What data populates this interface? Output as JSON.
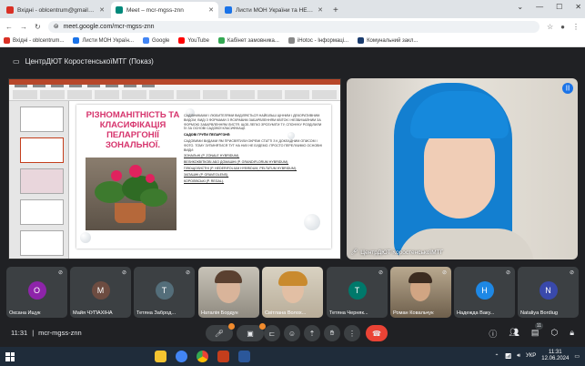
{
  "browser": {
    "tabs": [
      {
        "label": "Вхідні - oblcentrum@gmail.com",
        "favicon_color": "#d93025"
      },
      {
        "label": "Meet – mcr-mgss-znn",
        "favicon_color": "#00897b"
      },
      {
        "label": "Листи МОН України та НЕНЦ",
        "favicon_color": "#1a73e8"
      }
    ],
    "new_tab": "+",
    "url": "meet.google.com/mcr-mgss-znn",
    "bookmarks": [
      {
        "label": "Вхідні - oblcentrum...",
        "color": "#d93025"
      },
      {
        "label": "Листи МОН Україн...",
        "color": "#1a73e8"
      },
      {
        "label": "Google",
        "color": "#4285f4"
      },
      {
        "label": "YouTube",
        "color": "#ff0000"
      },
      {
        "label": "Кабінет замовника...",
        "color": "#34a853"
      },
      {
        "label": "iHotoc - Інформаці...",
        "color": "#888888"
      },
      {
        "label": "Комунальний закл...",
        "color": "#1a3c6e"
      }
    ]
  },
  "meet": {
    "presenter_title": "ЦентрДЮТ КоростенськоїМТГ (Показ)",
    "slide": {
      "title": "РІЗНОМАНІТНІСТЬ ТА КЛАСИФІКАЦІЯ ПЕЛАРГОНІЇ ЗОНАЛЬНОЇ.",
      "paragraphs": [
        "САДІВНИКАМИ І ЛЮБИТЕЛЯМИ ВИДІЛЯЄТЬСЯ НАЙБІЛЬШ ЦІННИМ І ДЕКОРАТИВНИМ ВИДОМ, ВИДІ З ФОРМАМИ З ЯСКРАВИМ ЗАБАРВЛЕННЯМ КВІТОК І НЕЗВИЧАЙНИМ ЗА ФОРМОЮ ЗАБАРВЛЕННЯМ ЛИСТЯ. ЩОБ ЛЕГКО ЗРОЗУМІТИ ТУ, СПОНУКУ РОЗДІЛИЛИ ЇХ ЗА ОСНОВІ САДОВОЇ КЛАСИФІКАЦІЇ.",
        "САДОВІ ГРУПИ ПЕЛАРГОНІЇ:",
        "САДОВИМИ ВИДАМИ ЯМ ПРИСВЯТИЛИ ОКРЕМІ СТАТТІ З К ДОКЛАДНИМ ОПИСОМ І ФОТО. ТОМУ ЗУПИНЯТИСЯ ТУТ НА НИХ НЕ БУДЕМО. ПРОСТО ПЕРЕЛІЧИМО ОСНОВНІ ВИДИ:",
        "ЗОНАЛЬНІ (P. ZONALE HYBRIDUM).",
        "ВЕЛИКОКВІТКОВІ АБО ДОМАШНІ (P. GRANDIFLORUM HYBRIDUM).",
        "ПЛЮЩОЛИСТНІ (P. HEDERIFOLIUM HYBRIDUM, PELTATUM HYBRIDUM).",
        "ЗАПАШНІ (P. GRAVEOLENS).",
        "КОРОЛІВСЬКІ (P. REGAL)."
      ]
    },
    "main_video": {
      "name": "ЦентрДЮТ КоростенськоїМТГ"
    },
    "participants": [
      {
        "name": "Оксана Ищук",
        "initial": "О",
        "color": "#8e24aa",
        "video": false
      },
      {
        "name": "Майя ЧУПАХІНА",
        "initial": "М",
        "color": "#6d4c41",
        "video": false
      },
      {
        "name": "Тетяна Заброд...",
        "initial": "Т",
        "color": "#546e7a",
        "video": false
      },
      {
        "name": "Наталія Бордун",
        "initial": "",
        "color": "",
        "video": true
      },
      {
        "name": "Світлана Волох...",
        "initial": "",
        "color": "",
        "video": true
      },
      {
        "name": "Тетяна Черняк...",
        "initial": "Т",
        "color": "#00796b",
        "video": false
      },
      {
        "name": "Роман Ковальчук",
        "initial": "",
        "color": "",
        "video": true
      },
      {
        "name": "Надежда Ваку...",
        "initial": "Н",
        "color": "#1e88e5",
        "video": false
      },
      {
        "name": "Nataliya Bordiug",
        "initial": "N",
        "color": "#3949ab",
        "video": false
      }
    ],
    "bottom": {
      "time": "11:31",
      "separator": "|",
      "meeting_code": "mcr-mgss-znn",
      "people_count": "11"
    }
  },
  "taskbar": {
    "lang": "УКР",
    "time": "11:31",
    "date": "12.06.2024"
  }
}
